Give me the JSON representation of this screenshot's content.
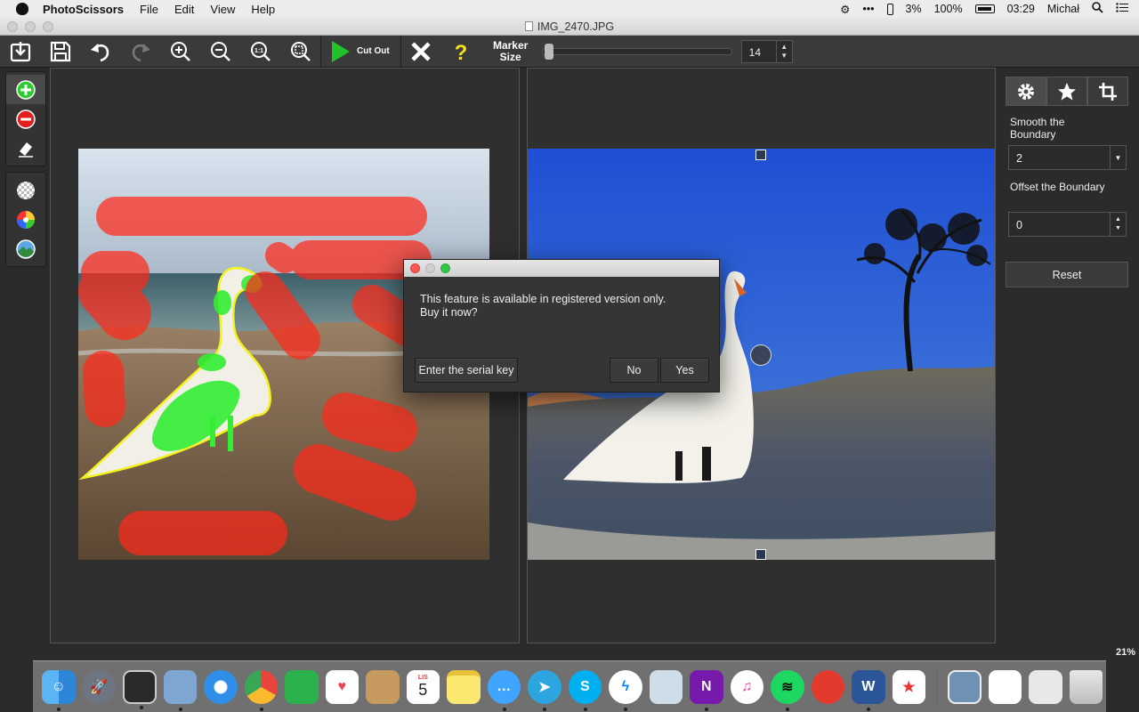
{
  "menubar": {
    "app_name": "PhotoScissors",
    "items": [
      "File",
      "Edit",
      "View",
      "Help"
    ],
    "status": {
      "cpu": "3%",
      "battery": "100%",
      "time": "03:29",
      "user": "Michał"
    }
  },
  "window": {
    "title": "IMG_2470.JPG"
  },
  "toolbar": {
    "cut_out_label": "Cut Out",
    "marker_label_line1": "Marker",
    "marker_label_line2": "Size",
    "marker_size": "14",
    "slider_level": 0.02
  },
  "right_panel": {
    "smooth_label": "Smooth the Boundary",
    "smooth_value": "2",
    "offset_label": "Offset the Boundary",
    "offset_value": "0",
    "reset_label": "Reset"
  },
  "zoom": "21%",
  "dialog": {
    "line1": "This feature is available in registered version only.",
    "line2": "Buy it now?",
    "serial_button": "Enter the serial key",
    "no_button": "No",
    "yes_button": "Yes"
  },
  "dock": {
    "calendar_month": "LIS",
    "calendar_day": "5"
  },
  "colors": {
    "accent_green": "#22c22a",
    "marker_red": "#ff2a1a",
    "marker_green": "#33ee33",
    "outline_yellow": "#f2f21c"
  }
}
